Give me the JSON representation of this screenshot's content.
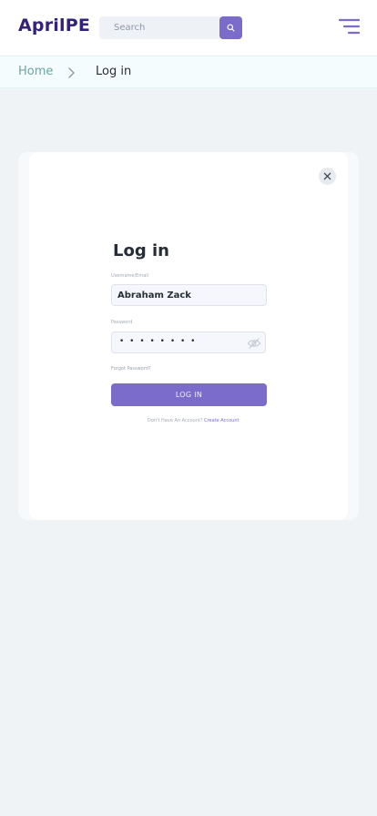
{
  "header": {
    "logo": "AprilPE",
    "search": {
      "placeholder": "Search"
    },
    "icons": {
      "search": "search-icon",
      "menu": "menu-icon"
    }
  },
  "breadcrumb": {
    "home": "Home",
    "current": "Log in",
    "separator_icon": "chevron-right-icon"
  },
  "login_form": {
    "title": "Log in",
    "username_label": "Username/Email",
    "username_value": "Abraham Zack",
    "password_label": "Password",
    "password_value": "• • • • • • • •",
    "forgot_password": "Forgot Password?",
    "submit_label": "LOG IN",
    "no_account_text": "Don't Have An Account?",
    "create_account_link": "Create Account",
    "close_icon": "close-icon",
    "eye_icon": "eye-off-icon"
  },
  "colors": {
    "brand": "#33227a",
    "accent": "#7b6bcb",
    "breadcrumb_home": "#6aa6a3",
    "page_background": "#eff3f6"
  }
}
